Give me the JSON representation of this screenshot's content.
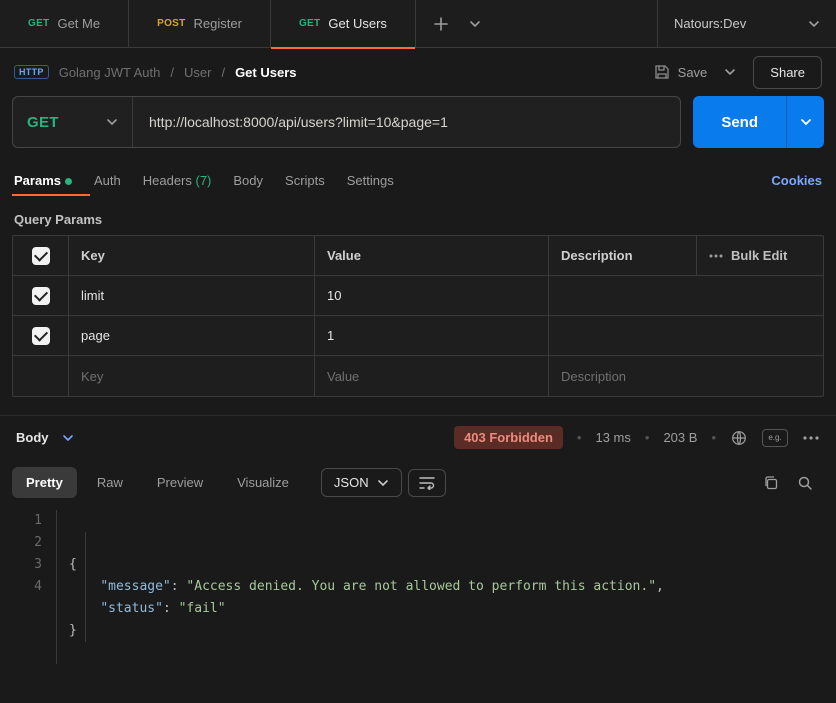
{
  "tabs": [
    {
      "method": "GET",
      "label": "Get Me",
      "active": false
    },
    {
      "method": "POST",
      "label": "Register",
      "active": false
    },
    {
      "method": "GET",
      "label": "Get Users",
      "active": true
    }
  ],
  "environment": {
    "name": "Natours:Dev"
  },
  "breadcrumb": {
    "badge": "HTTP",
    "parts": [
      "Golang JWT Auth",
      "User",
      "Get Users"
    ]
  },
  "actions": {
    "save": "Save",
    "share": "Share"
  },
  "request": {
    "method": "GET",
    "url": "http://localhost:8000/api/users?limit=10&page=1",
    "send": "Send"
  },
  "req_tabs": {
    "params": "Params",
    "auth": "Auth",
    "headers": "Headers",
    "headers_count": "(7)",
    "body": "Body",
    "scripts": "Scripts",
    "settings": "Settings",
    "cookies": "Cookies"
  },
  "params": {
    "title": "Query Params",
    "headers": {
      "key": "Key",
      "value": "Value",
      "desc": "Description",
      "bulk": "Bulk Edit"
    },
    "rows": [
      {
        "enabled": true,
        "key": "limit",
        "value": "10",
        "desc": ""
      },
      {
        "enabled": true,
        "key": "page",
        "value": "1",
        "desc": ""
      }
    ],
    "placeholders": {
      "key": "Key",
      "value": "Value",
      "desc": "Description"
    }
  },
  "response": {
    "label": "Body",
    "status": "403 Forbidden",
    "time": "13 ms",
    "size": "203 B",
    "view_tabs": {
      "pretty": "Pretty",
      "raw": "Raw",
      "preview": "Preview",
      "visualize": "Visualize"
    },
    "format": "JSON",
    "json_lines": [
      "{",
      "    \"message\": \"Access denied. You are not allowed to perform this action.\",",
      "    \"status\": \"fail\"",
      "}"
    ],
    "json": {
      "message": "Access denied. You are not allowed to perform this action.",
      "status": "fail"
    }
  }
}
